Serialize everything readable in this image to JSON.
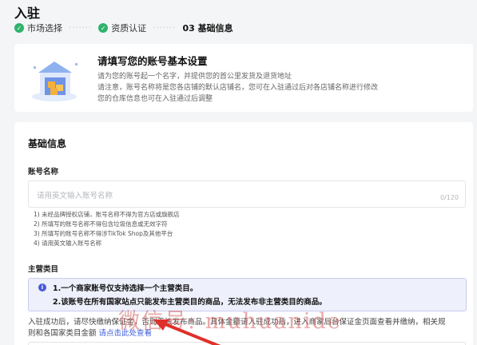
{
  "page": {
    "title": "入驻"
  },
  "steps": [
    {
      "label": "市场选择",
      "state": "done"
    },
    {
      "label": "资质认证",
      "state": "done"
    },
    {
      "label": "03 基础信息",
      "state": "current"
    }
  ],
  "intro": {
    "title": "请填写您的账号基本设置",
    "lines": [
      "请为您的账号起一个名字，并提供您的首公里发货及退货地址",
      "请注意，账号名称将是您各店铺的默认店铺名，您可在入驻通过后对各店铺名称进行修改",
      "您的仓库信息也可在入驻通过后调整"
    ],
    "illustration_icon": "warehouse-illustration"
  },
  "form": {
    "section_title": "基础信息",
    "account_name": {
      "label": "账号名称",
      "placeholder": "请用英文输入账号名称",
      "counter": "0/120"
    },
    "hints": [
      "1) 未经品牌授权店铺，账号名称不得为官方店或旗舰店",
      "2) 所填写的账号名称不得包含垃圾信息或无效字符",
      "3) 所填写的账号名称不得涉TikTok Shop及其他平台",
      "4) 请用英文输入账号名称"
    ],
    "main_category": {
      "label": "主营类目",
      "notice": [
        "1.一个商家账号仅支持选择一个主营类目。",
        "2.该账号在所有国家站点只能发布主营类目的商品，无法发布非主营类目的商品。"
      ],
      "description_line1": "入驻成功后，请尽快缴纳保证金，否则无法发布商品。具体金额请入驻成功后，进入商家后台保证金页面查看并缴纳，相关规",
      "description_line2_prefix": "则和各国家类目金额",
      "description_link": "请点击此处查看"
    }
  },
  "watermark": "微信号: muhuanide",
  "colors": {
    "success": "#2fb36b",
    "accent": "#4a58d8",
    "link": "#3d5bd9",
    "arrow": "#e0302a"
  }
}
